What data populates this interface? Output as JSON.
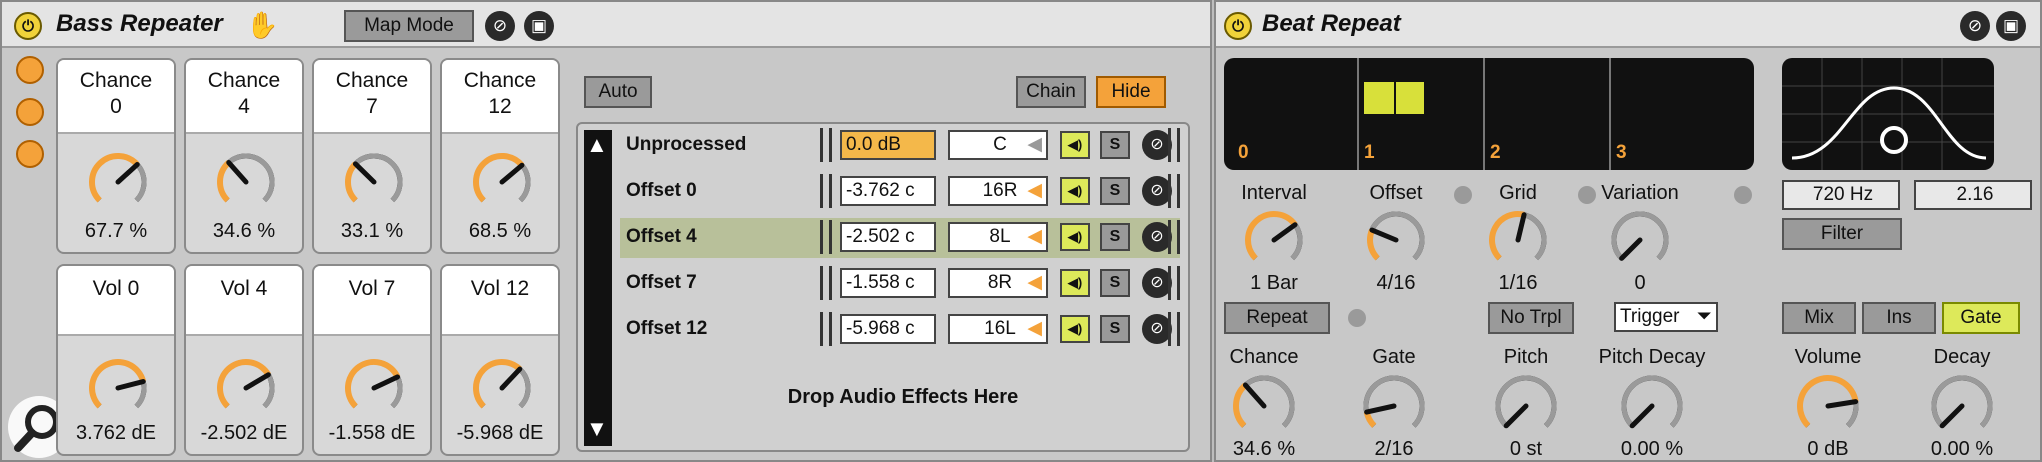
{
  "bass_repeater": {
    "title": "Bass Repeater",
    "map_mode_label": "Map Mode",
    "chance_knobs": [
      {
        "label": "Chance",
        "sub": "0",
        "value": "67.7 %",
        "level": 0.677
      },
      {
        "label": "Chance",
        "sub": "4",
        "value": "34.6 %",
        "level": 0.346
      },
      {
        "label": "Chance",
        "sub": "7",
        "value": "33.1 %",
        "level": 0.331
      },
      {
        "label": "Chance",
        "sub": "12",
        "value": "68.5 %",
        "level": 0.685
      }
    ],
    "vol_knobs": [
      {
        "label": "Vol 0",
        "value": "3.762 dE",
        "level": 0.78
      },
      {
        "label": "Vol 4",
        "value": "-2.502 dE",
        "level": 0.72
      },
      {
        "label": "Vol 7",
        "value": "-1.558 dE",
        "level": 0.74
      },
      {
        "label": "Vol 12",
        "value": "-5.968 dE",
        "level": 0.66
      }
    ],
    "chain": {
      "auto_label": "Auto",
      "chain_label": "Chain",
      "hide_label": "Hide",
      "rows": [
        {
          "name": "Unprocessed",
          "volume": "0.0 dB",
          "pan": "C",
          "solo": "S",
          "selected": false,
          "vol_active": true
        },
        {
          "name": "Offset 0",
          "volume": "-3.762 c",
          "pan": "16R",
          "solo": "S",
          "selected": false,
          "vol_active": false
        },
        {
          "name": "Offset 4",
          "volume": "-2.502 c",
          "pan": "8L",
          "solo": "S",
          "selected": true,
          "vol_active": false
        },
        {
          "name": "Offset 7",
          "volume": "-1.558 c",
          "pan": "8R",
          "solo": "S",
          "selected": false,
          "vol_active": false
        },
        {
          "name": "Offset 12",
          "volume": "-5.968 c",
          "pan": "16L",
          "solo": "S",
          "selected": false,
          "vol_active": false
        }
      ],
      "drop_text": "Drop Audio Effects Here"
    }
  },
  "beat_repeat": {
    "title": "Beat Repeat",
    "display_ticks": [
      "0",
      "1",
      "2",
      "3"
    ],
    "filter_freq": "720 Hz",
    "filter_width": "2.16",
    "filter_label": "Filter",
    "top_knobs": [
      {
        "label": "Interval",
        "value": "1 Bar",
        "level": 0.7,
        "orange": true
      },
      {
        "label": "Offset",
        "value": "4/16",
        "level": 0.25,
        "orange": false
      },
      {
        "label": "Grid",
        "value": "1/16",
        "level": 0.55,
        "orange": true
      },
      {
        "label": "Variation",
        "value": "0",
        "level": 0.0,
        "orange": false
      }
    ],
    "repeat_label": "Repeat",
    "no_trpl_label": "No Trpl",
    "trigger_label": "Trigger",
    "mix_label": "Mix",
    "ins_label": "Ins",
    "gate_mode_label": "Gate",
    "bottom_knobs": [
      {
        "label": "Chance",
        "value": "34.6 %",
        "level": 0.346,
        "orange": false
      },
      {
        "label": "Gate",
        "value": "2/16",
        "level": 0.12,
        "orange": false
      },
      {
        "label": "Pitch",
        "value": "0 st",
        "level": 0.0,
        "orange": false
      },
      {
        "label": "Pitch Decay",
        "value": "0.00 %",
        "level": 0.0,
        "orange": false
      },
      {
        "label": "Volume",
        "value": "0 dB",
        "level": 0.8,
        "orange": true
      },
      {
        "label": "Decay",
        "value": "0.00 %",
        "level": 0.0,
        "orange": false
      }
    ]
  },
  "colors": {
    "accent": "#f4a23a",
    "active": "#dde95a",
    "display_bg": "#111111",
    "display_bar": "#d8e03a"
  },
  "icons": [
    "power-icon",
    "hand-icon",
    "hotswap-icon",
    "save-icon",
    "magnifier-icon",
    "scroll-up-icon",
    "scroll-down-icon"
  ]
}
